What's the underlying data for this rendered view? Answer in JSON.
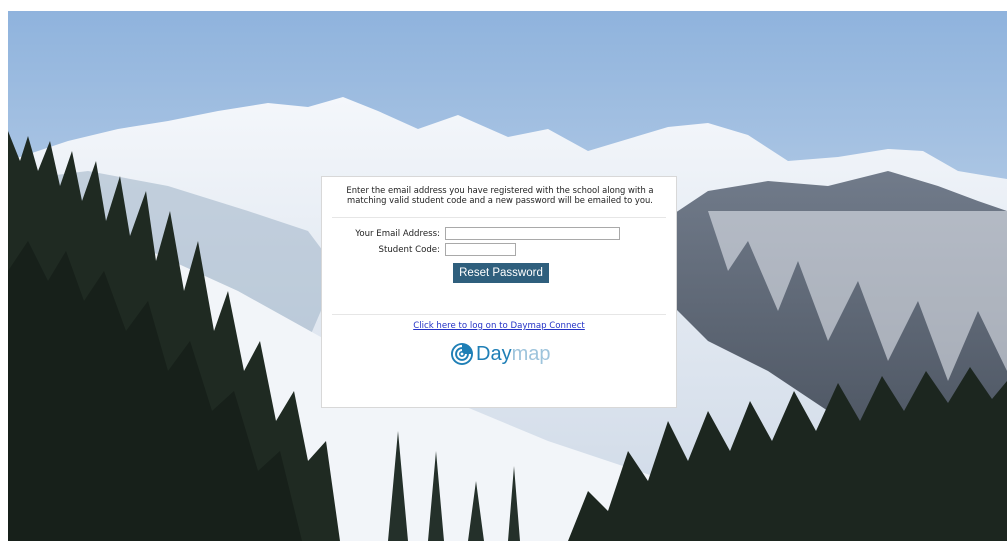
{
  "instructions": "Enter the email address you have registered with the school along with a matching valid student code and a new password will be emailed to you.",
  "form": {
    "email_label": "Your Email Address:",
    "email_value": "",
    "student_code_label": "Student Code:",
    "student_code_value": "",
    "submit_label": "Reset Password"
  },
  "login_link": "Click here to log on to Daymap Connect",
  "logo": {
    "text_part1": "Day",
    "text_part2": "map",
    "brand_color": "#1f7fb6",
    "light_color": "#9ec4dc",
    "icon": "daymap-swirl-icon"
  },
  "background": {
    "description_icon": "mountain-landscape-image"
  }
}
